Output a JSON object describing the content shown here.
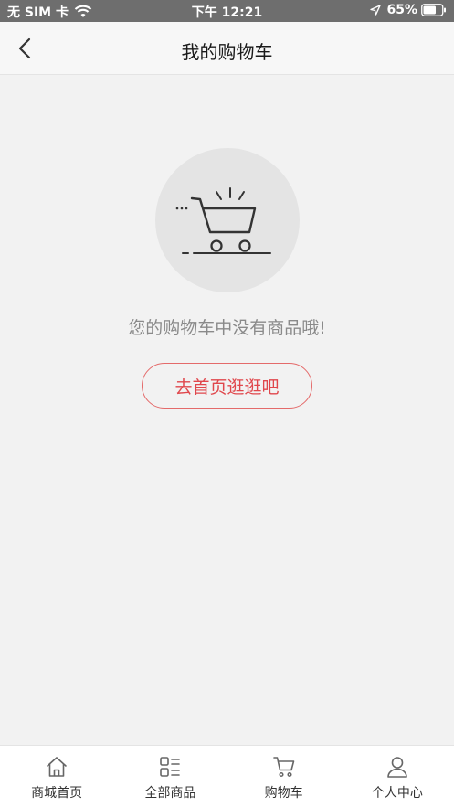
{
  "status_bar": {
    "carrier": "无 SIM 卡",
    "time": "下午 12:21",
    "battery": "65%"
  },
  "nav": {
    "title": "我的购物车"
  },
  "empty_state": {
    "message": "您的购物车中没有商品哦!",
    "button_label": "去首页逛逛吧"
  },
  "tabs": [
    {
      "label": "商城首页",
      "icon": "home-icon"
    },
    {
      "label": "全部商品",
      "icon": "category-icon"
    },
    {
      "label": "购物车",
      "icon": "cart-icon"
    },
    {
      "label": "个人中心",
      "icon": "user-icon"
    }
  ],
  "colors": {
    "accent": "#e0474c",
    "status_bar": "#6e6e6e",
    "background": "#f2f2f2"
  }
}
